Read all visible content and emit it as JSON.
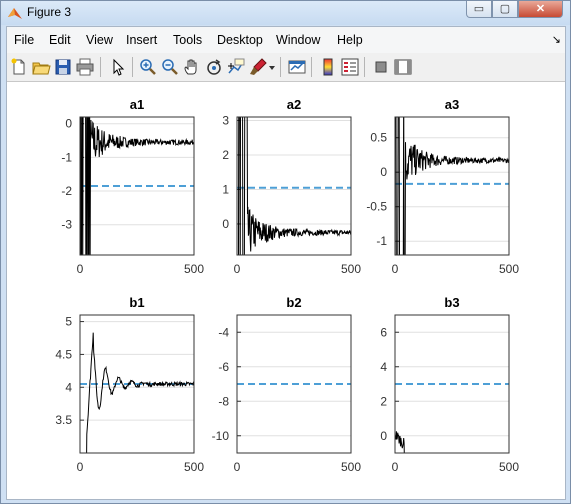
{
  "window": {
    "title": "Figure 3",
    "min_glyph": "▭",
    "max_glyph": "▢",
    "close_glyph": "✕"
  },
  "menu": [
    {
      "label": "File"
    },
    {
      "label": "Edit"
    },
    {
      "label": "View"
    },
    {
      "label": "Insert"
    },
    {
      "label": "Tools"
    },
    {
      "label": "Desktop"
    },
    {
      "label": "Window"
    },
    {
      "label": "Help"
    }
  ],
  "menu_arrow": "↘",
  "toolbar": {
    "icons": [
      "new-figure-icon",
      "open-file-icon",
      "save-icon",
      "print-icon",
      "pointer-icon",
      "zoom-in-icon",
      "zoom-out-icon",
      "pan-hand-icon",
      "rotate-3d-icon",
      "data-cursor-icon",
      "brush-icon",
      "brush-dropdown-icon",
      "link-plot-icon",
      "colorbar-icon",
      "legend-icon",
      "hide-plot-tools-icon",
      "show-plot-tools-icon"
    ]
  },
  "colors": {
    "signal": "#000000",
    "reference": "#4d9fd6",
    "grid": "#e0e0e0"
  },
  "chart_data": [
    {
      "type": "line",
      "title": "a1",
      "xlim": [
        0,
        500
      ],
      "ylim": [
        -3.9,
        0.2
      ],
      "xticks": [
        "0",
        "500"
      ],
      "yticks": [
        0,
        -1,
        -2,
        -3
      ],
      "reference": -1.85,
      "settle": -0.55,
      "grid": true
    },
    {
      "type": "line",
      "title": "a2",
      "xlim": [
        0,
        500
      ],
      "ylim": [
        -0.9,
        3.1
      ],
      "xticks": [
        "0",
        "500"
      ],
      "yticks": [
        3,
        2,
        1,
        0
      ],
      "reference": 1.05,
      "settle": -0.25,
      "grid": true
    },
    {
      "type": "line",
      "title": "a3",
      "xlim": [
        0,
        500
      ],
      "ylim": [
        -1.2,
        0.8
      ],
      "xticks": [
        "0",
        "500"
      ],
      "yticks": [
        0.5,
        0,
        -0.5,
        -1
      ],
      "reference": -0.17,
      "settle": 0.17,
      "grid": true
    },
    {
      "type": "line",
      "title": "b1",
      "xlim": [
        0,
        500
      ],
      "ylim": [
        3.0,
        5.1
      ],
      "xticks": [
        "0",
        "500"
      ],
      "yticks": [
        5,
        4.5,
        4,
        3.5
      ],
      "reference": 4.05,
      "settle": 4.05,
      "grid": true
    },
    {
      "type": "line",
      "title": "b2",
      "xlim": [
        0,
        500
      ],
      "ylim": [
        -11,
        -3
      ],
      "xticks": [
        "0",
        "500"
      ],
      "yticks": [
        -4,
        -6,
        -8,
        -10
      ],
      "reference": -7.0,
      "settle": null,
      "grid": true
    },
    {
      "type": "line",
      "title": "b3",
      "xlim": [
        0,
        500
      ],
      "ylim": [
        -1,
        7
      ],
      "xticks": [
        "0",
        "500"
      ],
      "yticks": [
        6,
        4,
        2,
        0
      ],
      "reference": 3.0,
      "settle": null,
      "grid": true
    }
  ]
}
